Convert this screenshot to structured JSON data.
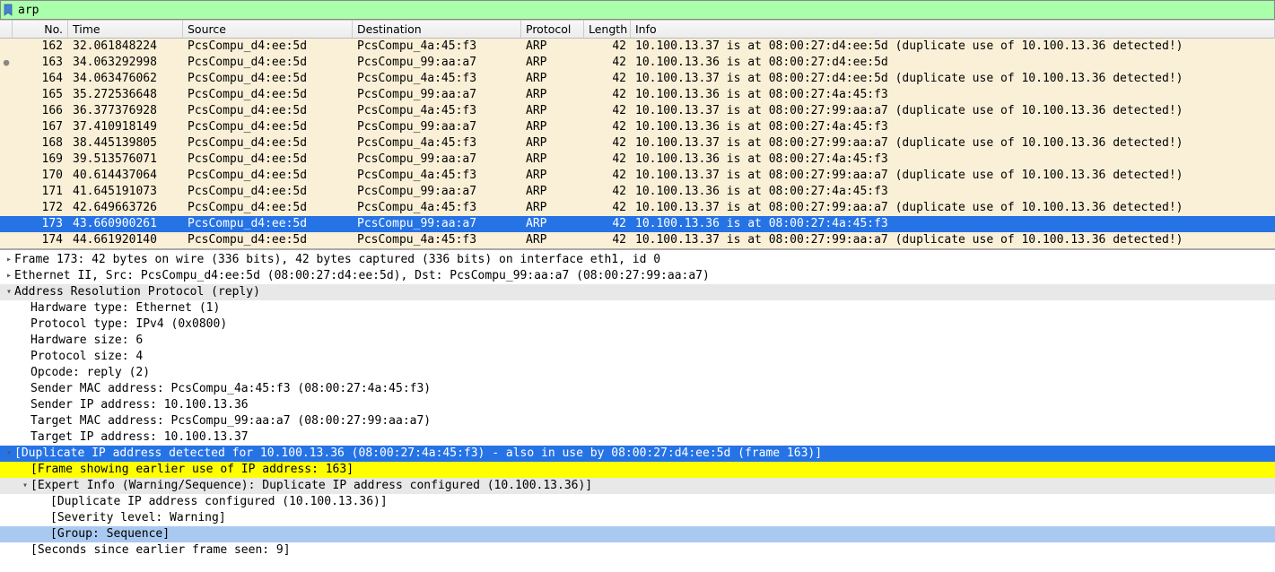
{
  "filter": {
    "value": "arp"
  },
  "columns": {
    "no": "No.",
    "time": "Time",
    "source": "Source",
    "destination": "Destination",
    "protocol": "Protocol",
    "length": "Length",
    "info": "Info"
  },
  "packets": [
    {
      "related": "",
      "no": "162",
      "time": "32.061848224",
      "src": "PcsCompu_d4:ee:5d",
      "dst": "PcsCompu_4a:45:f3",
      "proto": "ARP",
      "len": "42",
      "info": "10.100.13.37 is at 08:00:27:d4:ee:5d (duplicate use of 10.100.13.36 detected!)",
      "sel": false
    },
    {
      "related": "●",
      "no": "163",
      "time": "34.063292998",
      "src": "PcsCompu_d4:ee:5d",
      "dst": "PcsCompu_99:aa:a7",
      "proto": "ARP",
      "len": "42",
      "info": "10.100.13.36 is at 08:00:27:d4:ee:5d",
      "sel": false
    },
    {
      "related": "",
      "no": "164",
      "time": "34.063476062",
      "src": "PcsCompu_d4:ee:5d",
      "dst": "PcsCompu_4a:45:f3",
      "proto": "ARP",
      "len": "42",
      "info": "10.100.13.37 is at 08:00:27:d4:ee:5d (duplicate use of 10.100.13.36 detected!)",
      "sel": false
    },
    {
      "related": "",
      "no": "165",
      "time": "35.272536648",
      "src": "PcsCompu_d4:ee:5d",
      "dst": "PcsCompu_99:aa:a7",
      "proto": "ARP",
      "len": "42",
      "info": "10.100.13.36 is at 08:00:27:4a:45:f3",
      "sel": false
    },
    {
      "related": "",
      "no": "166",
      "time": "36.377376928",
      "src": "PcsCompu_d4:ee:5d",
      "dst": "PcsCompu_4a:45:f3",
      "proto": "ARP",
      "len": "42",
      "info": "10.100.13.37 is at 08:00:27:99:aa:a7 (duplicate use of 10.100.13.36 detected!)",
      "sel": false
    },
    {
      "related": "",
      "no": "167",
      "time": "37.410918149",
      "src": "PcsCompu_d4:ee:5d",
      "dst": "PcsCompu_99:aa:a7",
      "proto": "ARP",
      "len": "42",
      "info": "10.100.13.36 is at 08:00:27:4a:45:f3",
      "sel": false
    },
    {
      "related": "",
      "no": "168",
      "time": "38.445139805",
      "src": "PcsCompu_d4:ee:5d",
      "dst": "PcsCompu_4a:45:f3",
      "proto": "ARP",
      "len": "42",
      "info": "10.100.13.37 is at 08:00:27:99:aa:a7 (duplicate use of 10.100.13.36 detected!)",
      "sel": false
    },
    {
      "related": "",
      "no": "169",
      "time": "39.513576071",
      "src": "PcsCompu_d4:ee:5d",
      "dst": "PcsCompu_99:aa:a7",
      "proto": "ARP",
      "len": "42",
      "info": "10.100.13.36 is at 08:00:27:4a:45:f3",
      "sel": false
    },
    {
      "related": "",
      "no": "170",
      "time": "40.614437064",
      "src": "PcsCompu_d4:ee:5d",
      "dst": "PcsCompu_4a:45:f3",
      "proto": "ARP",
      "len": "42",
      "info": "10.100.13.37 is at 08:00:27:99:aa:a7 (duplicate use of 10.100.13.36 detected!)",
      "sel": false
    },
    {
      "related": "",
      "no": "171",
      "time": "41.645191073",
      "src": "PcsCompu_d4:ee:5d",
      "dst": "PcsCompu_99:aa:a7",
      "proto": "ARP",
      "len": "42",
      "info": "10.100.13.36 is at 08:00:27:4a:45:f3",
      "sel": false
    },
    {
      "related": "",
      "no": "172",
      "time": "42.649663726",
      "src": "PcsCompu_d4:ee:5d",
      "dst": "PcsCompu_4a:45:f3",
      "proto": "ARP",
      "len": "42",
      "info": "10.100.13.37 is at 08:00:27:99:aa:a7 (duplicate use of 10.100.13.36 detected!)",
      "sel": false
    },
    {
      "related": "",
      "no": "173",
      "time": "43.660900261",
      "src": "PcsCompu_d4:ee:5d",
      "dst": "PcsCompu_99:aa:a7",
      "proto": "ARP",
      "len": "42",
      "info": "10.100.13.36 is at 08:00:27:4a:45:f3",
      "sel": true
    },
    {
      "related": "",
      "no": "174",
      "time": "44.661920140",
      "src": "PcsCompu_d4:ee:5d",
      "dst": "PcsCompu_4a:45:f3",
      "proto": "ARP",
      "len": "42",
      "info": "10.100.13.37 is at 08:00:27:99:aa:a7 (duplicate use of 10.100.13.36 detected!)",
      "sel": false
    }
  ],
  "details": [
    {
      "indent": 0,
      "arrow": "▸",
      "hl": "",
      "text": "Frame 173: 42 bytes on wire (336 bits), 42 bytes captured (336 bits) on interface eth1, id 0"
    },
    {
      "indent": 0,
      "arrow": "▸",
      "hl": "",
      "text": "Ethernet II, Src: PcsCompu_d4:ee:5d (08:00:27:d4:ee:5d), Dst: PcsCompu_99:aa:a7 (08:00:27:99:aa:a7)"
    },
    {
      "indent": 0,
      "arrow": "▾",
      "hl": "grey",
      "text": "Address Resolution Protocol (reply)"
    },
    {
      "indent": 1,
      "arrow": "",
      "hl": "",
      "text": "Hardware type: Ethernet (1)"
    },
    {
      "indent": 1,
      "arrow": "",
      "hl": "",
      "text": "Protocol type: IPv4 (0x0800)"
    },
    {
      "indent": 1,
      "arrow": "",
      "hl": "",
      "text": "Hardware size: 6"
    },
    {
      "indent": 1,
      "arrow": "",
      "hl": "",
      "text": "Protocol size: 4"
    },
    {
      "indent": 1,
      "arrow": "",
      "hl": "",
      "text": "Opcode: reply (2)"
    },
    {
      "indent": 1,
      "arrow": "",
      "hl": "",
      "text": "Sender MAC address: PcsCompu_4a:45:f3 (08:00:27:4a:45:f3)"
    },
    {
      "indent": 1,
      "arrow": "",
      "hl": "",
      "text": "Sender IP address: 10.100.13.36"
    },
    {
      "indent": 1,
      "arrow": "",
      "hl": "",
      "text": "Target MAC address: PcsCompu_99:aa:a7 (08:00:27:99:aa:a7)"
    },
    {
      "indent": 1,
      "arrow": "",
      "hl": "",
      "text": "Target IP address: 10.100.13.37"
    },
    {
      "indent": 0,
      "arrow": "▾",
      "hl": "blue",
      "text": "[Duplicate IP address detected for 10.100.13.36 (08:00:27:4a:45:f3) - also in use by 08:00:27:d4:ee:5d (frame 163)]"
    },
    {
      "indent": 1,
      "arrow": "",
      "hl": "yellow",
      "text": "[Frame showing earlier use of IP address: 163]"
    },
    {
      "indent": 1,
      "arrow": "▾",
      "hl": "grey",
      "text": "[Expert Info (Warning/Sequence): Duplicate IP address configured (10.100.13.36)]"
    },
    {
      "indent": 2,
      "arrow": "",
      "hl": "",
      "text": "[Duplicate IP address configured (10.100.13.36)]"
    },
    {
      "indent": 2,
      "arrow": "",
      "hl": "",
      "text": "[Severity level: Warning]"
    },
    {
      "indent": 2,
      "arrow": "",
      "hl": "lightblue",
      "text": "[Group: Sequence]"
    },
    {
      "indent": 1,
      "arrow": "",
      "hl": "",
      "text": "[Seconds since earlier frame seen: 9]"
    }
  ]
}
